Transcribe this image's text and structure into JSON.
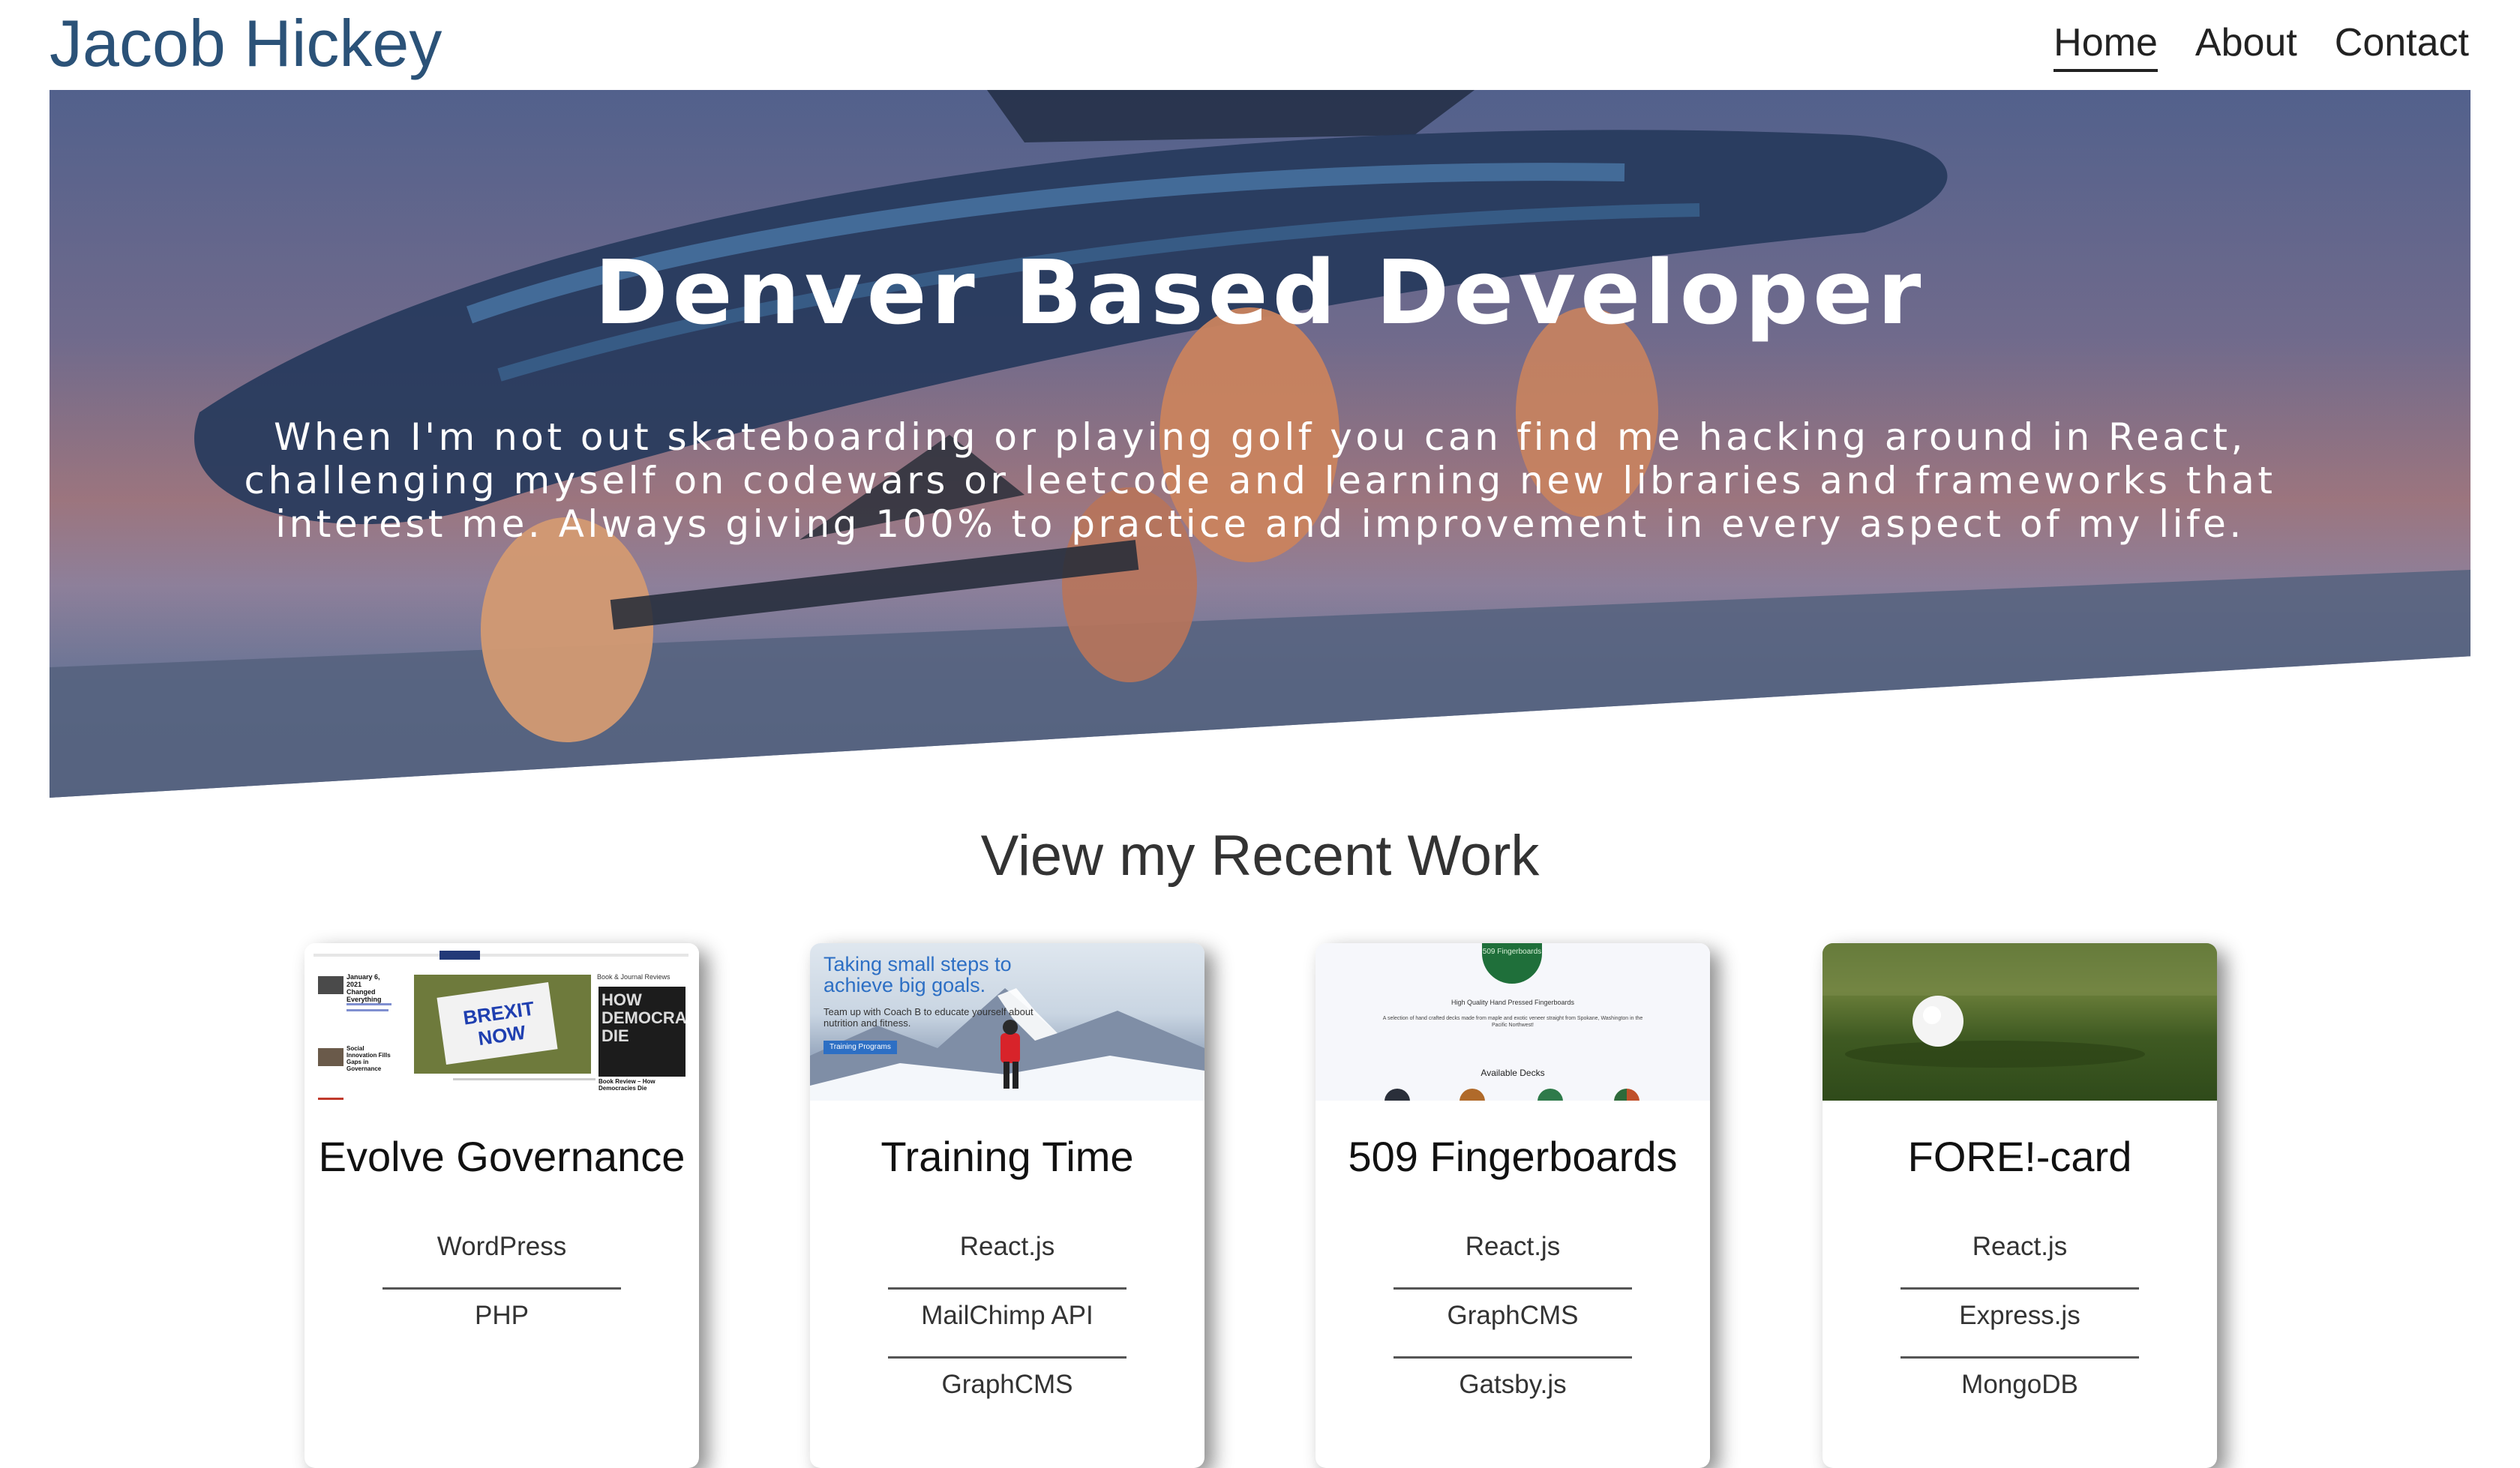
{
  "header": {
    "site_title": "Jacob Hickey",
    "nav": [
      {
        "label": "Home",
        "active": true
      },
      {
        "label": "About",
        "active": false
      },
      {
        "label": "Contact",
        "active": false
      }
    ]
  },
  "hero": {
    "heading": "Denver Based Developer",
    "text": "When I'm not out skateboarding or playing golf you can find me hacking around in React, challenging myself on codewars or leetcode and learning new libraries and frameworks that interest me. Always giving 100% to practice and improvement in every aspect of my life."
  },
  "work": {
    "heading": "View my Recent Work",
    "projects": [
      {
        "title": "Evolve Governance",
        "tech": [
          "WordPress",
          "PHP"
        ],
        "thumb": {
          "brexit_sign": "BREXIT NOW",
          "book_cover": "HOW DEMOCRACIES DIE",
          "section_label": "Book & Journal Reviews",
          "post_date": "January 6, 2021",
          "post_title": "Changed Everything",
          "post_title_2": "Social Innovation Fills Gaps in Governance",
          "review_title": "Book Review – How Democracies Die"
        }
      },
      {
        "title": "Training Time",
        "tech": [
          "React.js",
          "MailChimp API",
          "GraphCMS"
        ],
        "thumb": {
          "headline": "Taking small steps to achieve big goals.",
          "sub": "Team up with Coach B to educate yourself about nutrition and fitness.",
          "button": "Training Programs"
        }
      },
      {
        "title": "509 Fingerboards",
        "tech": [
          "React.js",
          "GraphCMS",
          "Gatsby.js"
        ],
        "thumb": {
          "tagline": "High Quality Hand Pressed Fingerboards",
          "desc": "A selection of hand crafted decks made from maple and exotic veneer straight from Spokane, Washington in the Pacific Northwest!",
          "section": "Available Decks",
          "logo": "509 Fingerboards"
        }
      },
      {
        "title": "FORE!-card",
        "tech": [
          "React.js",
          "Express.js",
          "MongoDB"
        ],
        "thumb": {}
      }
    ]
  },
  "colors": {
    "title_blue": "#2b5278",
    "hero_overlay": "#34426c",
    "text_dark": "#222222"
  }
}
